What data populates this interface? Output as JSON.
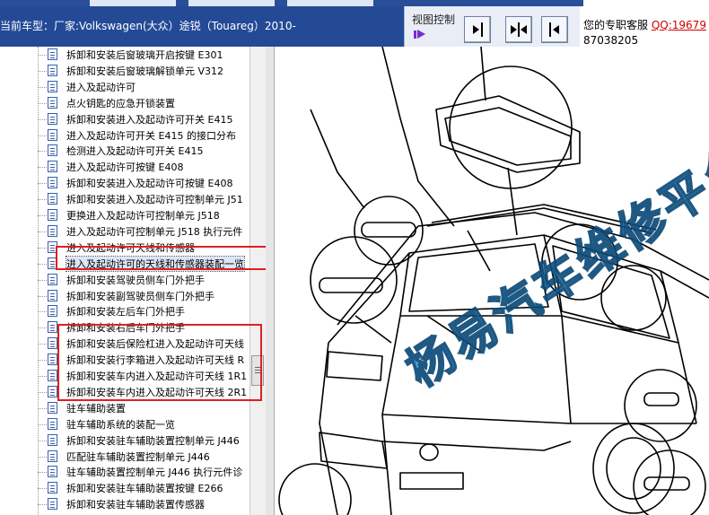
{
  "header": {
    "model_text": "当前车型：厂家:Volkswagen(大众）途锐（Touareg）2010-",
    "view_control_label": "视图控制",
    "buttons": [
      {
        "name": "expand-right-button",
        "icon": "arrow-right-icon"
      },
      {
        "name": "split-view-button",
        "icon": "split-arrows-icon"
      },
      {
        "name": "expand-left-button",
        "icon": "arrow-left-icon"
      }
    ],
    "service_label": "您的专职客服",
    "service_qq": "QQ:19679",
    "service_phone": "87038205"
  },
  "tree": {
    "items": [
      {
        "label": "拆卸和安装后窗玻璃开启按键 E301"
      },
      {
        "label": "拆卸和安装后窗玻璃解锁单元 V312"
      },
      {
        "label": "进入及起动许可"
      },
      {
        "label": "点火钥匙的应急开锁装置"
      },
      {
        "label": "拆卸和安装进入及起动许可开关 E415"
      },
      {
        "label": "进入及起动许可开关 E415 的接口分布"
      },
      {
        "label": "检测进入及起动许可开关 E415"
      },
      {
        "label": "进入及起动许可按键 E408"
      },
      {
        "label": "拆卸和安装进入及起动许可按键 E408"
      },
      {
        "label": "拆卸和安装进入及起动许可控制单元 J51"
      },
      {
        "label": "更换进入及起动许可控制单元 J518"
      },
      {
        "label": "进入及起动许可控制单元 J518 执行元件"
      },
      {
        "label": "进入及起动许可天线和传感器"
      },
      {
        "label": "进入及起动许可的天线和传感器装配一览"
      },
      {
        "label": "拆卸和安装驾驶员侧车门外把手"
      },
      {
        "label": "拆卸和安装副驾驶员侧车门外把手"
      },
      {
        "label": "拆卸和安装左后车门外把手"
      },
      {
        "label": "拆卸和安装右后车门外把手"
      },
      {
        "label": "拆卸和安装后保险杠进入及起动许可天线"
      },
      {
        "label": "拆卸和安装行李箱进入及起动许可天线 R"
      },
      {
        "label": "拆卸和安装车内进入及起动许可天线 1R1"
      },
      {
        "label": "拆卸和安装车内进入及起动许可天线 2R1"
      },
      {
        "label": "驻车辅助装置"
      },
      {
        "label": "驻车辅助系统的装配一览"
      },
      {
        "label": "拆卸和安装驻车辅助装置控制单元 J446"
      },
      {
        "label": "匹配驻车辅助装置控制单元 J446"
      },
      {
        "label": "驻车辅助装置控制单元 J446 执行元件诊"
      },
      {
        "label": "拆卸和安装驻车辅助装置按键 E266"
      },
      {
        "label": "拆卸和安装驻车辅助装置传感器"
      }
    ],
    "selected_index": 13
  },
  "diagram": {
    "watermark": "杨易汽车维修平台"
  },
  "colors": {
    "header_blue": "#244a96",
    "highlight_red": "#e02020",
    "qq_red": "#d10000",
    "watermark_blue": "#3a9bd6"
  }
}
